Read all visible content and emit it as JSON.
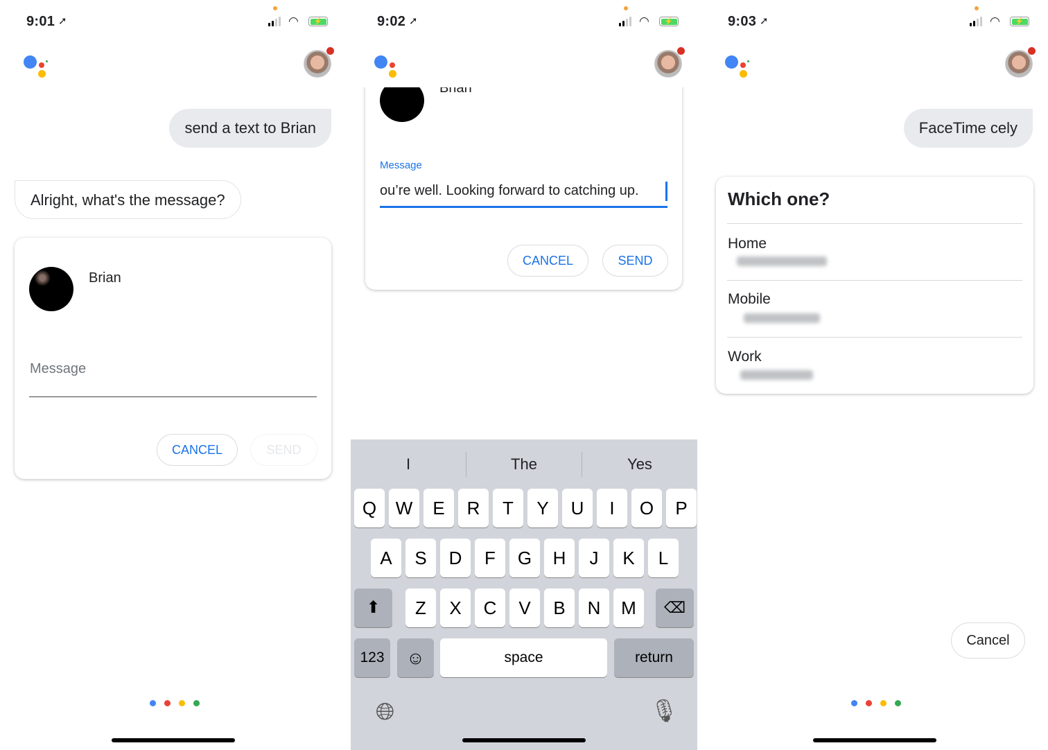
{
  "colors": {
    "google_blue": "#4285f4",
    "google_red": "#ea4335",
    "google_yellow": "#fbbc04",
    "google_green": "#34a853",
    "link_blue": "#1a73e8"
  },
  "panels": [
    {
      "time": "9:01",
      "user_query": "send a text to Brian",
      "assistant_reply": "Alright, what's the message?",
      "card": {
        "contact_name": "Brian",
        "message_placeholder": "Message",
        "cancel_label": "CANCEL",
        "send_label": "SEND"
      }
    },
    {
      "time": "9:02",
      "card": {
        "contact_name": "Brian",
        "message_label": "Message",
        "message_value": "ou’re well. Looking forward to catching up.",
        "cancel_label": "CANCEL",
        "send_label": "SEND"
      },
      "keyboard": {
        "suggestions": [
          "I",
          "The",
          "Yes"
        ],
        "row1": [
          "Q",
          "W",
          "E",
          "R",
          "T",
          "Y",
          "U",
          "I",
          "O",
          "P"
        ],
        "row2": [
          "A",
          "S",
          "D",
          "F",
          "G",
          "H",
          "J",
          "K",
          "L"
        ],
        "row3": [
          "Z",
          "X",
          "C",
          "V",
          "B",
          "N",
          "M"
        ],
        "numbers_label": "123",
        "space_label": "space",
        "return_label": "return"
      }
    },
    {
      "time": "9:03",
      "user_query": "FaceTime cely",
      "card": {
        "title": "Which one?",
        "options": [
          {
            "label": "Home"
          },
          {
            "label": "Mobile"
          },
          {
            "label": "Work"
          }
        ]
      },
      "cancel_label": "Cancel"
    }
  ]
}
